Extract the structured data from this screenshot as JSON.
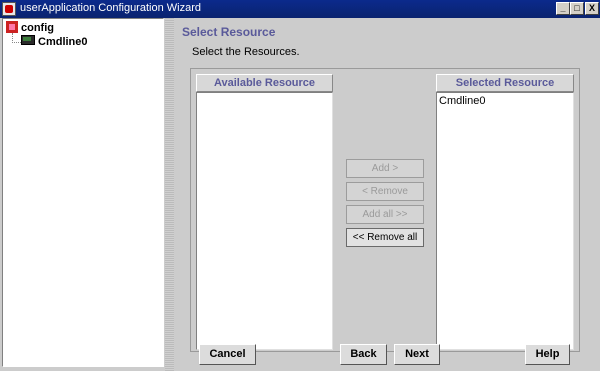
{
  "window": {
    "title": "userApplication Configuration Wizard",
    "controls": {
      "minimize": "_",
      "maximize": "□",
      "close": "X"
    }
  },
  "tree": {
    "root": {
      "label": "config",
      "icon": "config-tree-icon"
    },
    "children": [
      {
        "label": "Cmdline0",
        "icon": "cmdline-resource-icon"
      }
    ]
  },
  "page": {
    "title": "Select Resource",
    "instruction": "Select the Resources."
  },
  "available": {
    "header": "Available Resource",
    "items": []
  },
  "selected": {
    "header": "Selected Resource",
    "items": [
      "Cmdline0"
    ]
  },
  "transfer_buttons": {
    "add": "Add >",
    "remove": "< Remove",
    "add_all": "Add all >>",
    "remove_all": "<< Remove all"
  },
  "nav_buttons": {
    "cancel": "Cancel",
    "back": "Back",
    "next": "Next",
    "help": "Help"
  },
  "colors": {
    "title_bar": "#0a236f",
    "section_heading": "#5a5a9a",
    "disabled_text": "#9a9a9a"
  }
}
